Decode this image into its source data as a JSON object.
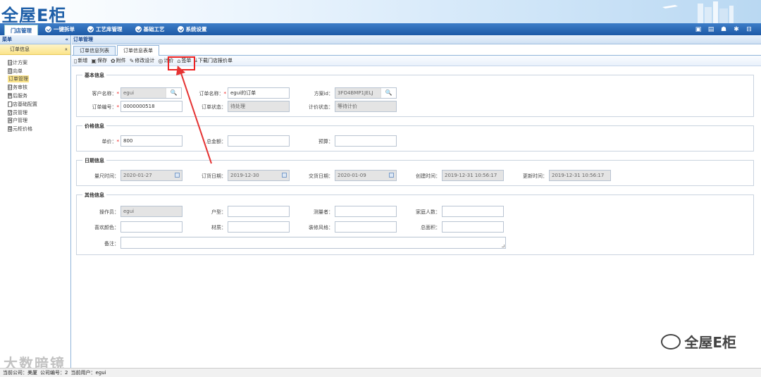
{
  "app": {
    "logo": "全屋E柜"
  },
  "nav": {
    "tabs": [
      {
        "label": "门店管理",
        "active": true
      },
      {
        "label": "一键拆单"
      },
      {
        "label": "工艺库管理"
      },
      {
        "label": "基础工艺"
      },
      {
        "label": "系统设置"
      }
    ]
  },
  "sidebar": {
    "header": "菜单",
    "collapse": "«",
    "section": "订单信息",
    "section_toggle": "»",
    "items": [
      {
        "label": "设计方案"
      },
      {
        "label": "意向单"
      },
      {
        "label": "订单管理",
        "active": true
      },
      {
        "label": "财务审核"
      },
      {
        "label": "售后服务"
      },
      {
        "label": "门店基础配置"
      },
      {
        "label": "店员管理"
      },
      {
        "label": "客户管理"
      },
      {
        "label": "单元柜价格"
      }
    ]
  },
  "main": {
    "breadcrumb": "订单管理",
    "tabs": [
      {
        "label": "订单信息列表"
      },
      {
        "label": "订单信息表单",
        "active": true
      }
    ],
    "toolbar": [
      {
        "label": "新增",
        "icon": "new-icon"
      },
      {
        "label": "保存",
        "icon": "save-icon"
      },
      {
        "label": "附件",
        "icon": "attachment-icon"
      },
      {
        "label": "修改设计",
        "icon": "edit-icon"
      },
      {
        "label": "计价",
        "icon": "price-icon"
      },
      {
        "label": "签单",
        "icon": "sign-icon"
      },
      {
        "label": "下载门店报价单",
        "icon": "download-icon"
      }
    ]
  },
  "form": {
    "basic": {
      "title": "基本信息",
      "customer_label": "客户名称：",
      "customer_value": "egui",
      "order_name_label": "订单名称：",
      "order_name_value": "egui的订单",
      "plan_id_label": "方案id：",
      "plan_id_value": "3FO4BMP1JELJ",
      "order_no_label": "订单编号：",
      "order_no_value": "0000000518",
      "order_status_label": "订单状态：",
      "order_status_value": "待处理",
      "price_status_label": "计价状态：",
      "price_status_value": "等待计价"
    },
    "price": {
      "title": "价格信息",
      "unit_label": "单价：",
      "unit_value": "800",
      "total_label": "总金额：",
      "total_value": "",
      "budget_label": "预算：",
      "budget_value": ""
    },
    "date": {
      "title": "日期信息",
      "measure_label": "量尺时间：",
      "measure_value": "2020-01-27",
      "order_date_label": "订货日期：",
      "order_date_value": "2019-12-30",
      "delivery_label": "交货日期：",
      "delivery_value": "2020-01-09",
      "created_label": "创建时间：",
      "created_value": "2019-12-31 10:56:17",
      "updated_label": "更新时间：",
      "updated_value": "2019-12-31 10:56:17"
    },
    "other": {
      "title": "其他信息",
      "operator_label": "操作员：",
      "operator_value": "egui",
      "house_type_label": "户型：",
      "house_type_value": "",
      "measurer_label": "测量者：",
      "measurer_value": "",
      "family_label": "家庭人数：",
      "family_value": "",
      "color_label": "喜欢颜色：",
      "color_value": "",
      "material_label": "材质：",
      "material_value": "",
      "style_label": "装修风格：",
      "style_value": "",
      "area_label": "总面积：",
      "area_value": "",
      "note_label": "备注：",
      "note_value": ""
    }
  },
  "watermark": {
    "right": "全屋E柜",
    "left": "大数暗镜"
  },
  "status": {
    "company": "当前公司：美厦",
    "company_no": "公司编号：2",
    "user": "当前用户：egui"
  }
}
